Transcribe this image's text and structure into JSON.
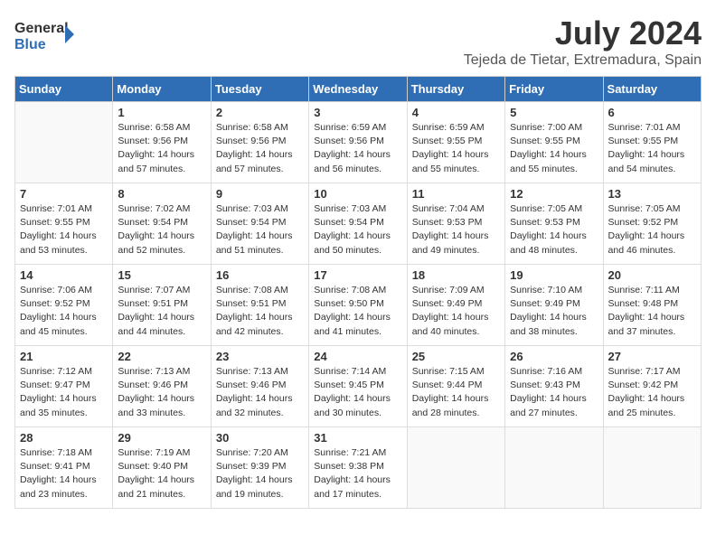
{
  "header": {
    "logo_line1": "General",
    "logo_line2": "Blue",
    "month": "July 2024",
    "location": "Tejeda de Tietar, Extremadura, Spain"
  },
  "weekdays": [
    "Sunday",
    "Monday",
    "Tuesday",
    "Wednesday",
    "Thursday",
    "Friday",
    "Saturday"
  ],
  "weeks": [
    [
      {
        "day": "",
        "detail": ""
      },
      {
        "day": "1",
        "detail": "Sunrise: 6:58 AM\nSunset: 9:56 PM\nDaylight: 14 hours\nand 57 minutes."
      },
      {
        "day": "2",
        "detail": "Sunrise: 6:58 AM\nSunset: 9:56 PM\nDaylight: 14 hours\nand 57 minutes."
      },
      {
        "day": "3",
        "detail": "Sunrise: 6:59 AM\nSunset: 9:56 PM\nDaylight: 14 hours\nand 56 minutes."
      },
      {
        "day": "4",
        "detail": "Sunrise: 6:59 AM\nSunset: 9:55 PM\nDaylight: 14 hours\nand 55 minutes."
      },
      {
        "day": "5",
        "detail": "Sunrise: 7:00 AM\nSunset: 9:55 PM\nDaylight: 14 hours\nand 55 minutes."
      },
      {
        "day": "6",
        "detail": "Sunrise: 7:01 AM\nSunset: 9:55 PM\nDaylight: 14 hours\nand 54 minutes."
      }
    ],
    [
      {
        "day": "7",
        "detail": "Sunrise: 7:01 AM\nSunset: 9:55 PM\nDaylight: 14 hours\nand 53 minutes."
      },
      {
        "day": "8",
        "detail": "Sunrise: 7:02 AM\nSunset: 9:54 PM\nDaylight: 14 hours\nand 52 minutes."
      },
      {
        "day": "9",
        "detail": "Sunrise: 7:03 AM\nSunset: 9:54 PM\nDaylight: 14 hours\nand 51 minutes."
      },
      {
        "day": "10",
        "detail": "Sunrise: 7:03 AM\nSunset: 9:54 PM\nDaylight: 14 hours\nand 50 minutes."
      },
      {
        "day": "11",
        "detail": "Sunrise: 7:04 AM\nSunset: 9:53 PM\nDaylight: 14 hours\nand 49 minutes."
      },
      {
        "day": "12",
        "detail": "Sunrise: 7:05 AM\nSunset: 9:53 PM\nDaylight: 14 hours\nand 48 minutes."
      },
      {
        "day": "13",
        "detail": "Sunrise: 7:05 AM\nSunset: 9:52 PM\nDaylight: 14 hours\nand 46 minutes."
      }
    ],
    [
      {
        "day": "14",
        "detail": "Sunrise: 7:06 AM\nSunset: 9:52 PM\nDaylight: 14 hours\nand 45 minutes."
      },
      {
        "day": "15",
        "detail": "Sunrise: 7:07 AM\nSunset: 9:51 PM\nDaylight: 14 hours\nand 44 minutes."
      },
      {
        "day": "16",
        "detail": "Sunrise: 7:08 AM\nSunset: 9:51 PM\nDaylight: 14 hours\nand 42 minutes."
      },
      {
        "day": "17",
        "detail": "Sunrise: 7:08 AM\nSunset: 9:50 PM\nDaylight: 14 hours\nand 41 minutes."
      },
      {
        "day": "18",
        "detail": "Sunrise: 7:09 AM\nSunset: 9:49 PM\nDaylight: 14 hours\nand 40 minutes."
      },
      {
        "day": "19",
        "detail": "Sunrise: 7:10 AM\nSunset: 9:49 PM\nDaylight: 14 hours\nand 38 minutes."
      },
      {
        "day": "20",
        "detail": "Sunrise: 7:11 AM\nSunset: 9:48 PM\nDaylight: 14 hours\nand 37 minutes."
      }
    ],
    [
      {
        "day": "21",
        "detail": "Sunrise: 7:12 AM\nSunset: 9:47 PM\nDaylight: 14 hours\nand 35 minutes."
      },
      {
        "day": "22",
        "detail": "Sunrise: 7:13 AM\nSunset: 9:46 PM\nDaylight: 14 hours\nand 33 minutes."
      },
      {
        "day": "23",
        "detail": "Sunrise: 7:13 AM\nSunset: 9:46 PM\nDaylight: 14 hours\nand 32 minutes."
      },
      {
        "day": "24",
        "detail": "Sunrise: 7:14 AM\nSunset: 9:45 PM\nDaylight: 14 hours\nand 30 minutes."
      },
      {
        "day": "25",
        "detail": "Sunrise: 7:15 AM\nSunset: 9:44 PM\nDaylight: 14 hours\nand 28 minutes."
      },
      {
        "day": "26",
        "detail": "Sunrise: 7:16 AM\nSunset: 9:43 PM\nDaylight: 14 hours\nand 27 minutes."
      },
      {
        "day": "27",
        "detail": "Sunrise: 7:17 AM\nSunset: 9:42 PM\nDaylight: 14 hours\nand 25 minutes."
      }
    ],
    [
      {
        "day": "28",
        "detail": "Sunrise: 7:18 AM\nSunset: 9:41 PM\nDaylight: 14 hours\nand 23 minutes."
      },
      {
        "day": "29",
        "detail": "Sunrise: 7:19 AM\nSunset: 9:40 PM\nDaylight: 14 hours\nand 21 minutes."
      },
      {
        "day": "30",
        "detail": "Sunrise: 7:20 AM\nSunset: 9:39 PM\nDaylight: 14 hours\nand 19 minutes."
      },
      {
        "day": "31",
        "detail": "Sunrise: 7:21 AM\nSunset: 9:38 PM\nDaylight: 14 hours\nand 17 minutes."
      },
      {
        "day": "",
        "detail": ""
      },
      {
        "day": "",
        "detail": ""
      },
      {
        "day": "",
        "detail": ""
      }
    ]
  ]
}
